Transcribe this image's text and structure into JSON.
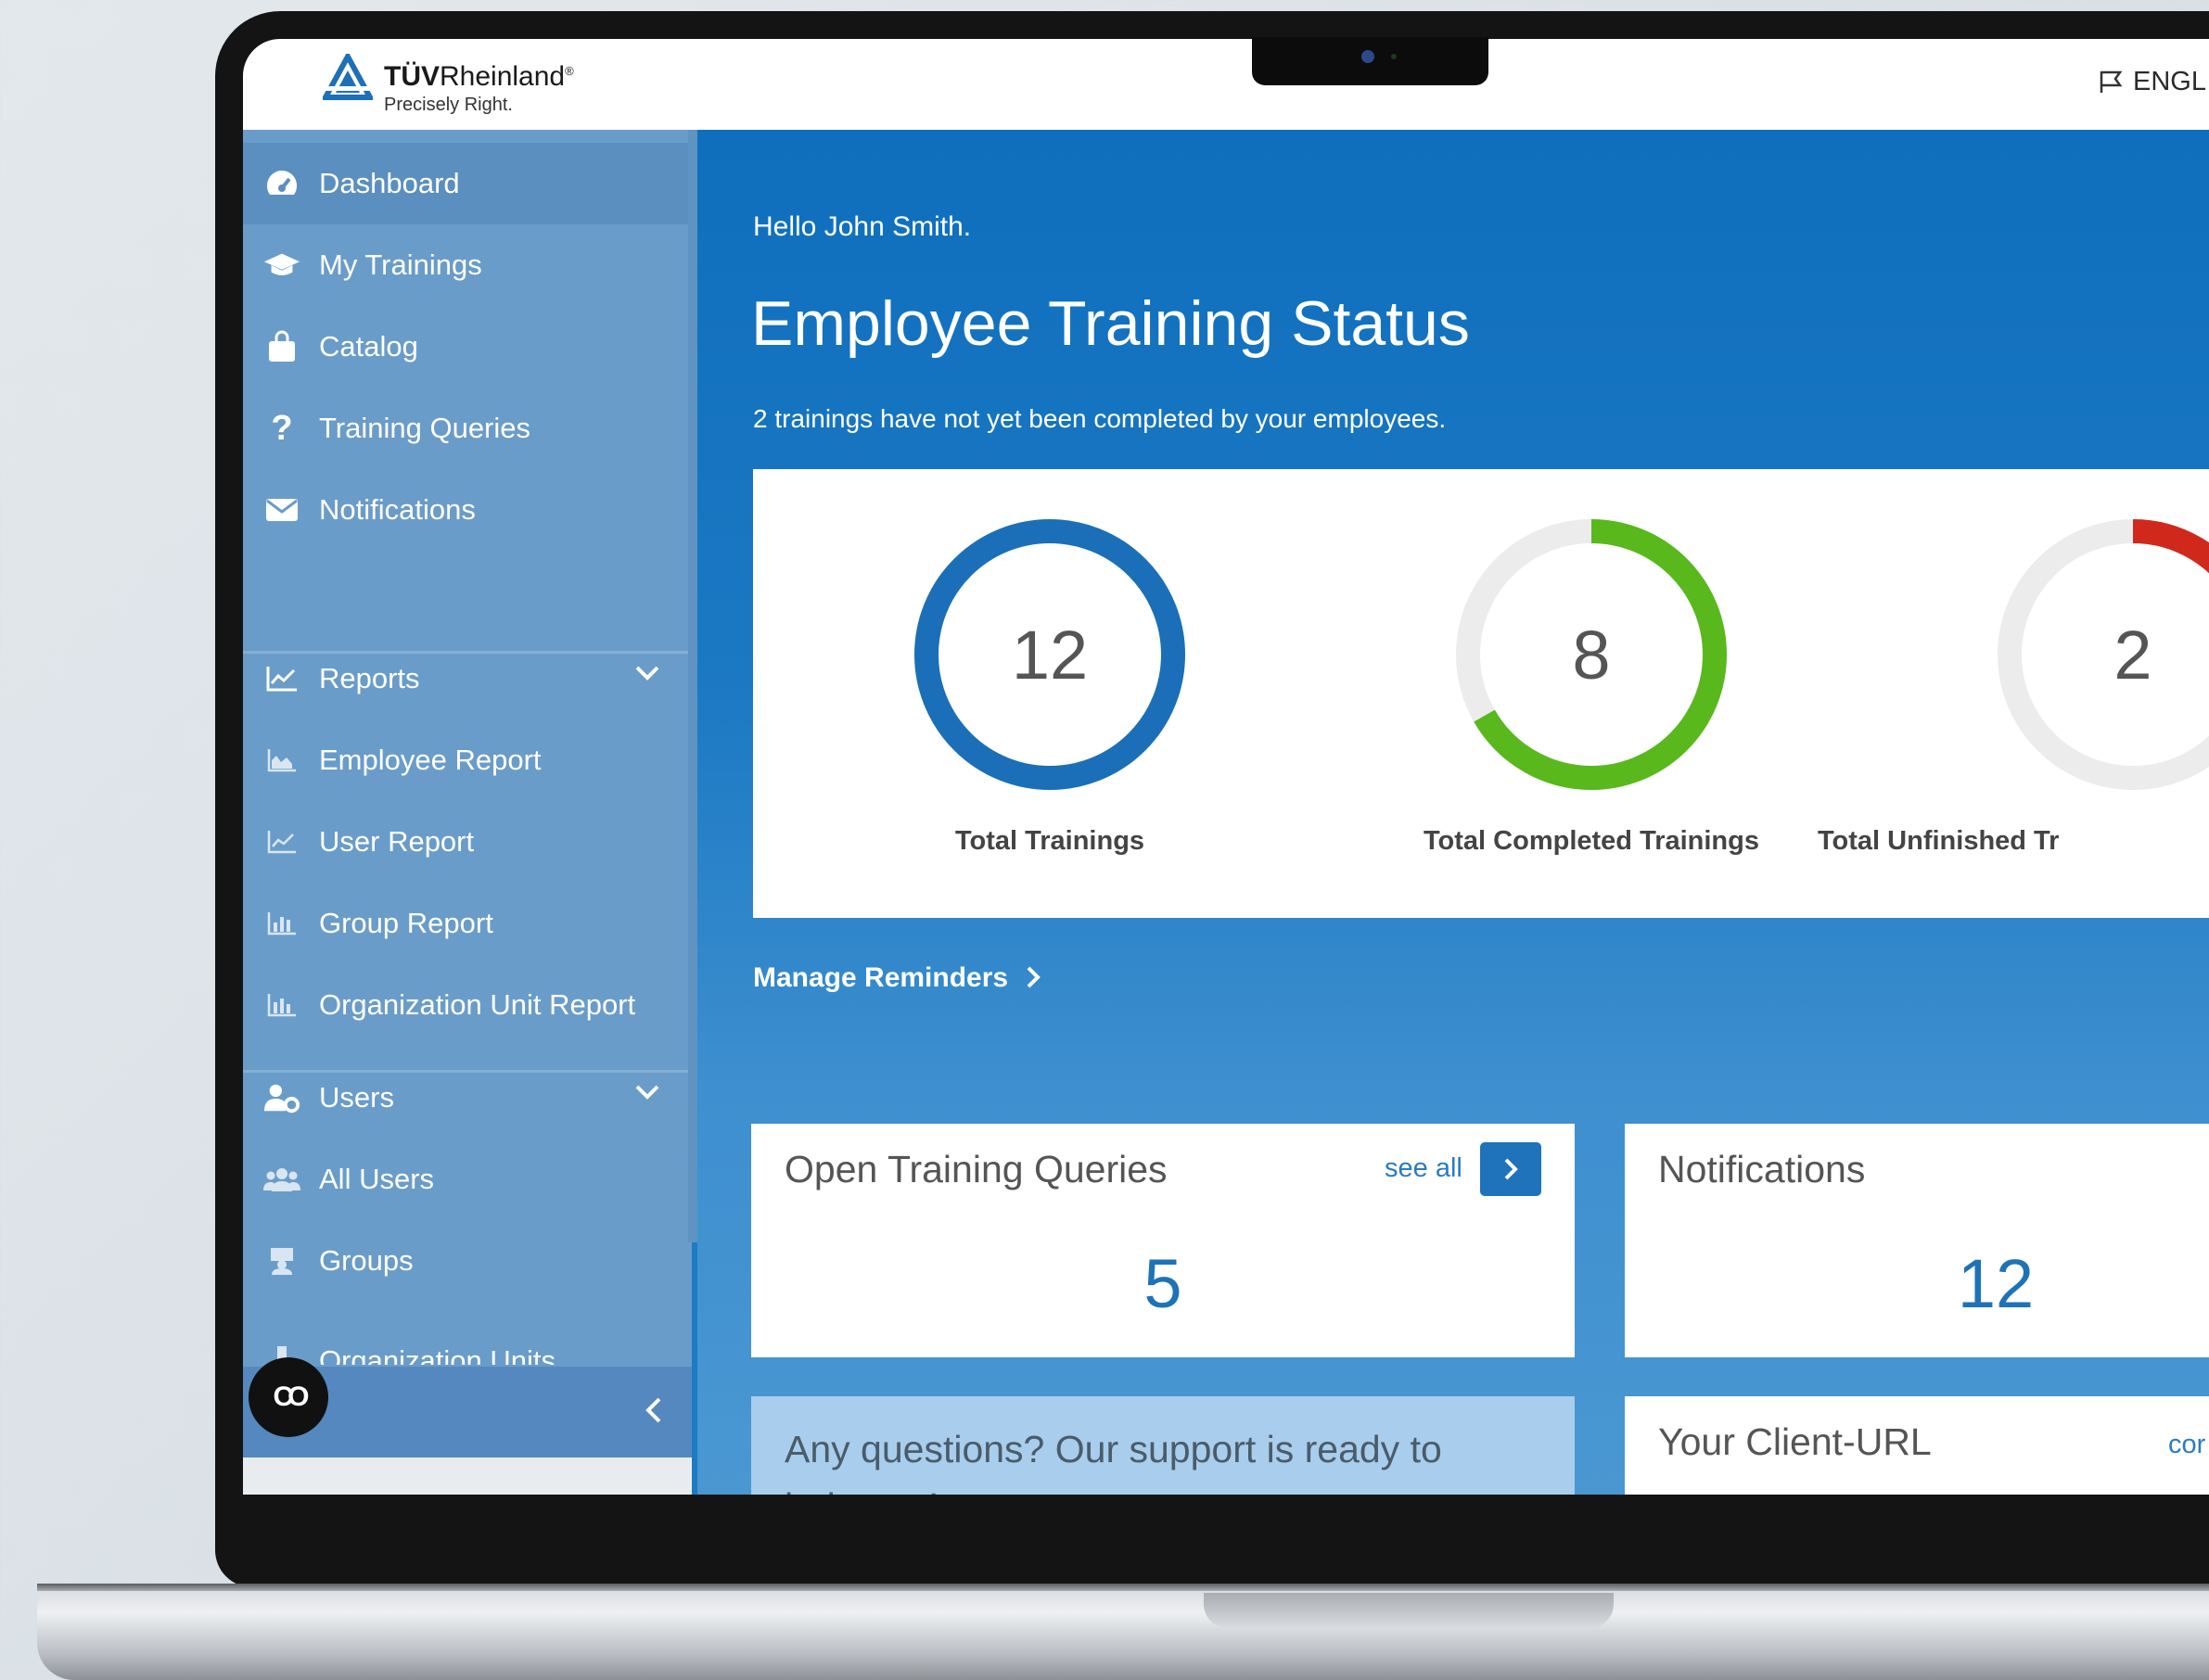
{
  "brand": {
    "name_bold": "TÜV",
    "name_rest": "Rheinland",
    "registered": "®",
    "tagline": "Precisely Right."
  },
  "header": {
    "language": "ENGL"
  },
  "greeting": "Hello John Smith.",
  "page_title": "Employee Training Status",
  "page_subtitle": "2 trainings have not yet been completed by your employees.",
  "sidebar": {
    "items": [
      {
        "label": "Dashboard",
        "icon": "dashboard-icon"
      },
      {
        "label": "My Trainings",
        "icon": "graduation-cap-icon"
      },
      {
        "label": "Catalog",
        "icon": "shopping-bag-icon"
      },
      {
        "label": "Training Queries",
        "icon": "question-icon"
      },
      {
        "label": "Notifications",
        "icon": "envelope-icon"
      }
    ],
    "reports": {
      "label": "Reports",
      "icon": "line-chart-icon",
      "children": [
        {
          "label": "Employee Report",
          "icon": "area-chart-icon"
        },
        {
          "label": "User Report",
          "icon": "line-chart-icon"
        },
        {
          "label": "Group Report",
          "icon": "bar-chart-icon"
        },
        {
          "label": "Organization Unit Report",
          "icon": "bar-chart-icon"
        }
      ]
    },
    "users": {
      "label": "Users",
      "icon": "user-gear-icon",
      "children": [
        {
          "label": "All Users",
          "icon": "users-icon"
        },
        {
          "label": "Groups",
          "icon": "group-icon"
        },
        {
          "label": "Organization Units",
          "icon": "org-unit-icon"
        }
      ]
    },
    "badge": "CO"
  },
  "stats": [
    {
      "value": "12",
      "label": "Total Trainings",
      "fraction": 1.0,
      "color": "#1a6fb8"
    },
    {
      "value": "8",
      "label": "Total Completed Trainings",
      "fraction": 0.667,
      "color": "#58b81c"
    },
    {
      "value": "2",
      "label": "Total Unfinished Tr",
      "fraction": 0.167,
      "color": "#d0291c"
    }
  ],
  "manage_reminders": "Manage Reminders",
  "cards": {
    "open_queries": {
      "title": "Open Training Queries",
      "see_all": "see all",
      "value": "5"
    },
    "notifications": {
      "title": "Notifications",
      "value": "12"
    },
    "support": {
      "text": "Any questions? Our support is ready to help you!"
    },
    "client_url": {
      "title": "Your Client-URL",
      "more": "cor"
    }
  },
  "colors": {
    "primary": "#1d7bc4",
    "sidebar": "#6a9cc9",
    "accent_blue": "#1f73ba",
    "green": "#58b81c",
    "red": "#d0291c"
  }
}
